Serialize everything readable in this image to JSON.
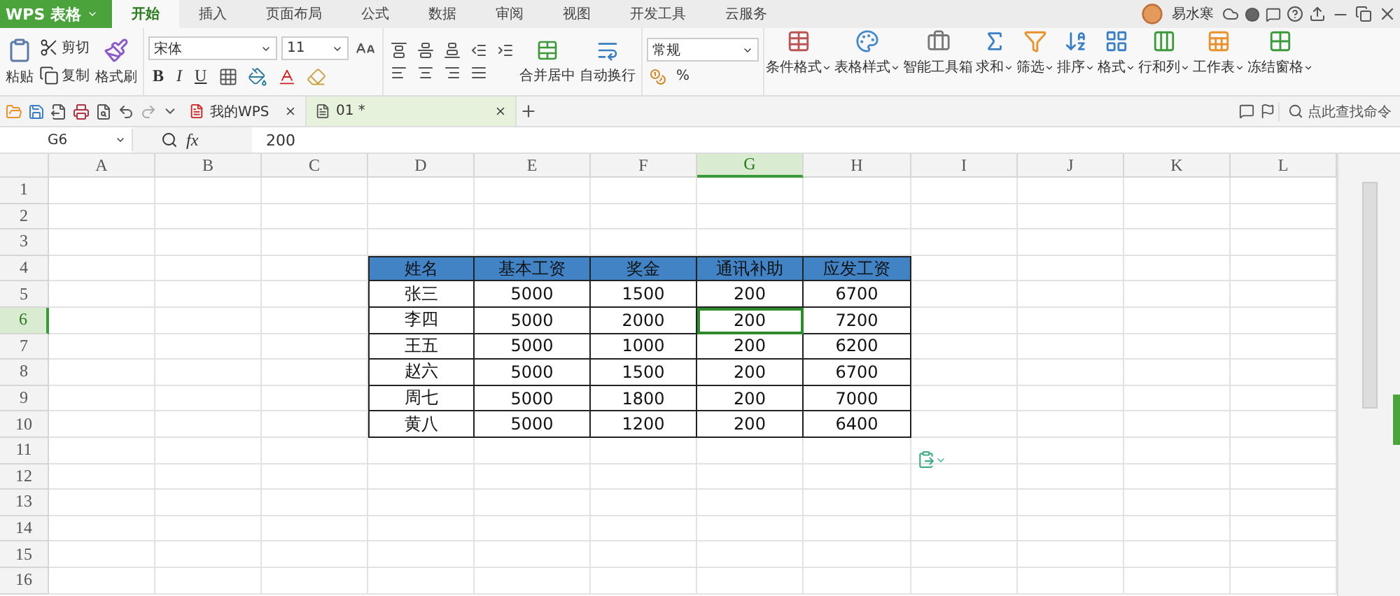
{
  "app_button": {
    "label": "WPS 表格"
  },
  "menu_tabs": [
    {
      "label": "开始",
      "selected": true
    },
    {
      "label": "插入",
      "selected": false
    },
    {
      "label": "页面布局",
      "selected": false
    },
    {
      "label": "公式",
      "selected": false
    },
    {
      "label": "数据",
      "selected": false
    },
    {
      "label": "审阅",
      "selected": false
    },
    {
      "label": "视图",
      "selected": false
    },
    {
      "label": "开发工具",
      "selected": false
    },
    {
      "label": "云服务",
      "selected": false
    }
  ],
  "user": {
    "name": "易水寒"
  },
  "clipboard": {
    "paste": "粘贴",
    "cut": "剪切",
    "copy": "复制",
    "painter": "格式刷"
  },
  "font": {
    "name": "宋体",
    "size": "11",
    "bold": "B",
    "italic": "I",
    "underline": "U"
  },
  "alignment": {
    "merge": "合并居中",
    "wrap": "自动换行"
  },
  "number": {
    "format": "常规",
    "percent": "%"
  },
  "tools": [
    {
      "kind": "conditional",
      "label": "条件格式",
      "dropdown": true
    },
    {
      "kind": "style",
      "label": "表格样式",
      "dropdown": true
    },
    {
      "kind": "toolbox",
      "label": "智能工具箱",
      "dropdown": false
    },
    {
      "kind": "sum",
      "label": "求和",
      "dropdown": true
    },
    {
      "kind": "filter",
      "label": "筛选",
      "dropdown": true
    },
    {
      "kind": "sort",
      "label": "排序",
      "dropdown": true
    },
    {
      "kind": "format",
      "label": "格式",
      "dropdown": true
    },
    {
      "kind": "rowcol",
      "label": "行和列",
      "dropdown": true
    },
    {
      "kind": "sheet",
      "label": "工作表",
      "dropdown": true
    },
    {
      "kind": "freeze",
      "label": "冻结窗格",
      "dropdown": true
    }
  ],
  "doc_tabs": [
    {
      "label": "我的WPS",
      "kind": "home",
      "selected": false
    },
    {
      "label": "01 *",
      "kind": "file",
      "selected": true
    }
  ],
  "command_search": {
    "placeholder": "点此查找命令"
  },
  "formula_bar": {
    "cell_ref": "G6",
    "fx": "fx",
    "value": "200"
  },
  "sheet": {
    "columns": [
      {
        "label": "A",
        "selected": false
      },
      {
        "label": "B",
        "selected": false
      },
      {
        "label": "C",
        "selected": false
      },
      {
        "label": "D",
        "selected": false
      },
      {
        "label": "E",
        "selected": false
      },
      {
        "label": "F",
        "selected": false
      },
      {
        "label": "G",
        "selected": true
      },
      {
        "label": "H",
        "selected": false
      },
      {
        "label": "I",
        "selected": false
      },
      {
        "label": "J",
        "selected": false
      },
      {
        "label": "K",
        "selected": false
      },
      {
        "label": "L",
        "selected": false
      }
    ],
    "rows": [
      {
        "label": "1",
        "selected": false
      },
      {
        "label": "2",
        "selected": false
      },
      {
        "label": "3",
        "selected": false
      },
      {
        "label": "4",
        "selected": false
      },
      {
        "label": "5",
        "selected": false
      },
      {
        "label": "6",
        "selected": true
      },
      {
        "label": "7",
        "selected": false
      },
      {
        "label": "8",
        "selected": false
      },
      {
        "label": "9",
        "selected": false
      },
      {
        "label": "10",
        "selected": false
      },
      {
        "label": "11",
        "selected": false
      },
      {
        "label": "12",
        "selected": false
      },
      {
        "label": "13",
        "selected": false
      },
      {
        "label": "14",
        "selected": false
      },
      {
        "label": "15",
        "selected": false
      },
      {
        "label": "16",
        "selected": false
      }
    ]
  },
  "table": {
    "headers": [
      "姓名",
      "基本工资",
      "奖金",
      "通讯补助",
      "应发工资"
    ],
    "rows": [
      [
        {
          "text": "张三",
          "selected": false
        },
        {
          "text": "5000",
          "selected": false
        },
        {
          "text": "1500",
          "selected": false
        },
        {
          "text": "200",
          "selected": false
        },
        {
          "text": "6700",
          "selected": false
        }
      ],
      [
        {
          "text": "李四",
          "selected": false
        },
        {
          "text": "5000",
          "selected": false
        },
        {
          "text": "2000",
          "selected": false
        },
        {
          "text": "200",
          "selected": true
        },
        {
          "text": "7200",
          "selected": false
        }
      ],
      [
        {
          "text": "王五",
          "selected": false
        },
        {
          "text": "5000",
          "selected": false
        },
        {
          "text": "1000",
          "selected": false
        },
        {
          "text": "200",
          "selected": false
        },
        {
          "text": "6200",
          "selected": false
        }
      ],
      [
        {
          "text": "赵六",
          "selected": false
        },
        {
          "text": "5000",
          "selected": false
        },
        {
          "text": "1500",
          "selected": false
        },
        {
          "text": "200",
          "selected": false
        },
        {
          "text": "6700",
          "selected": false
        }
      ],
      [
        {
          "text": "周七",
          "selected": false
        },
        {
          "text": "5000",
          "selected": false
        },
        {
          "text": "1800",
          "selected": false
        },
        {
          "text": "200",
          "selected": false
        },
        {
          "text": "7000",
          "selected": false
        }
      ],
      [
        {
          "text": "黄八",
          "selected": false
        },
        {
          "text": "5000",
          "selected": false
        },
        {
          "text": "1200",
          "selected": false
        },
        {
          "text": "200",
          "selected": false
        },
        {
          "text": "6400",
          "selected": false
        }
      ]
    ]
  }
}
